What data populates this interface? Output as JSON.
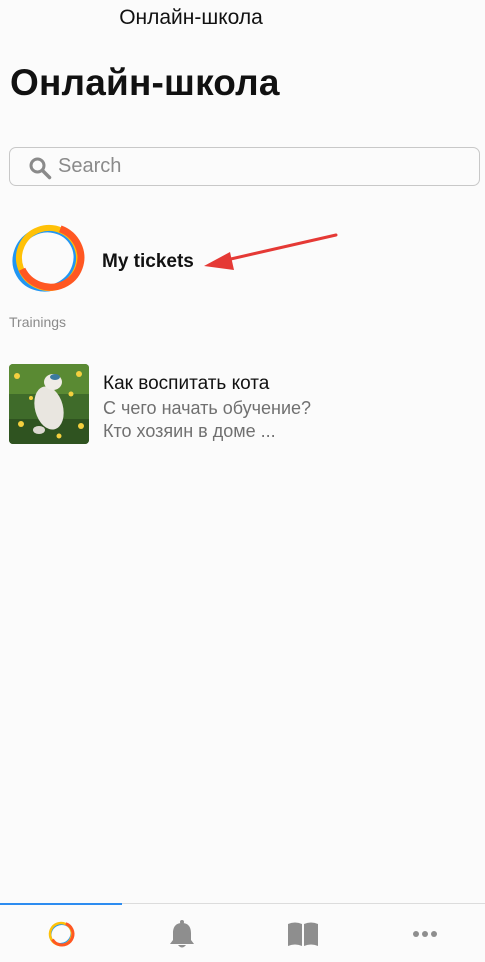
{
  "header": {
    "nav_title": "Онлайн-школа",
    "large_title": "Онлайн-школа"
  },
  "search": {
    "placeholder": "Search",
    "value": ""
  },
  "tickets": {
    "label": "My tickets",
    "logo_icon": "school-logo-icon"
  },
  "section": {
    "label": "Trainings"
  },
  "trainings": [
    {
      "title": "Как воспитать кота",
      "line1": "С чего начать обучение?",
      "line2": "Кто хозяин в доме ...",
      "thumb": "cat-photo"
    }
  ],
  "annotation": {
    "arrow_color": "#e53935"
  },
  "tabbar": {
    "tabs": [
      {
        "icon": "school-logo-icon",
        "active": true
      },
      {
        "icon": "bell-icon",
        "active": false
      },
      {
        "icon": "book-icon",
        "active": false
      },
      {
        "icon": "more-icon",
        "active": false
      }
    ],
    "accent": "#2d8cf0"
  }
}
